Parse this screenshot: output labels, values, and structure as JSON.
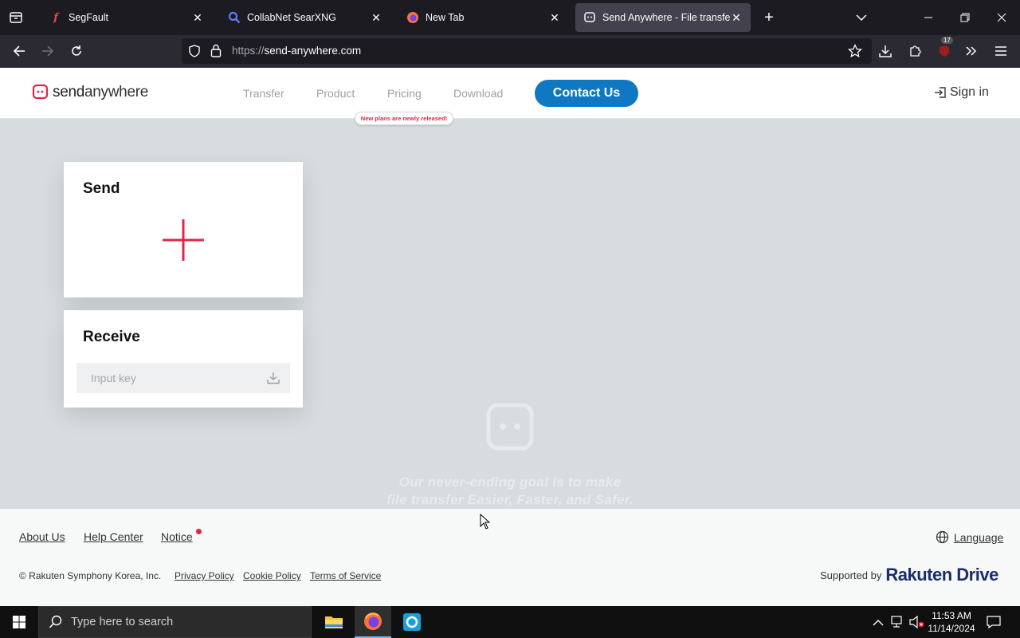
{
  "browser": {
    "tabs": [
      {
        "title": "SegFault"
      },
      {
        "title": "CollabNet SearXNG"
      },
      {
        "title": "New Tab"
      },
      {
        "title": "Send Anywhere - File transfer"
      }
    ],
    "url_proto": "https://",
    "url_host": "send-anywhere.com",
    "extension_badge": "17"
  },
  "header": {
    "logo_send": "send",
    "logo_anywhere": "anywhere",
    "nav": [
      "Transfer",
      "Product",
      "Pricing",
      "Download"
    ],
    "contact_label": "Contact Us",
    "pricing_badge": "New plans are newly released!",
    "signin_label": "Sign in"
  },
  "send_card": {
    "title": "Send"
  },
  "receive_card": {
    "title": "Receive",
    "input_placeholder": "Input key"
  },
  "tagline": {
    "line1": "Our never-ending goal is to make",
    "line2": "file transfer Easier, Faster, and Safer."
  },
  "footer": {
    "links": [
      "About Us",
      "Help Center",
      "Notice"
    ],
    "language_label": "Language",
    "copyright": "© Rakuten Symphony Korea, Inc.",
    "small_links": [
      "Privacy Policy",
      "Cookie Policy",
      "Terms of Service"
    ],
    "supported_by": "Supported by",
    "brand_rakuten": "Rakuten",
    "brand_drive": "Drive"
  },
  "taskbar": {
    "search_placeholder": "Type here to search",
    "time": "11:53 AM",
    "date": "11/14/2024"
  },
  "colors": {
    "accent_pink": "#e1264a",
    "contact_blue": "#0f78c2",
    "page_bg": "#d6dcdf"
  }
}
